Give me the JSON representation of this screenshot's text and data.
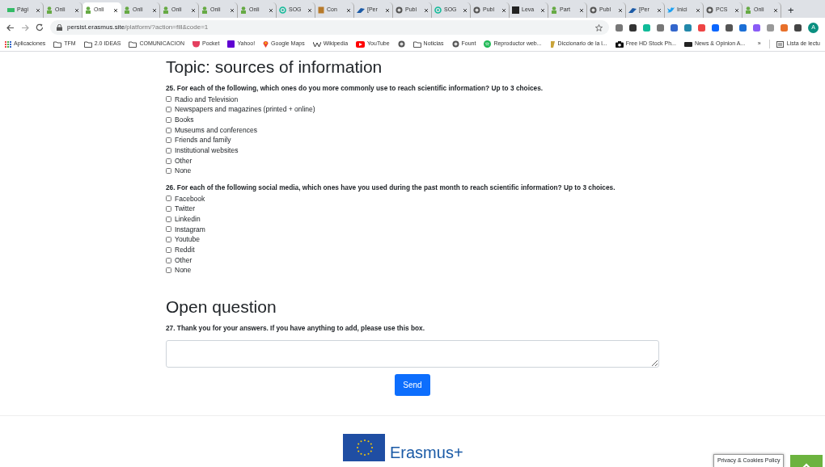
{
  "browser": {
    "tabs": [
      {
        "title": "Pági",
        "kind": "sp",
        "selected": false
      },
      {
        "title": "Onli",
        "kind": "person",
        "selected": false
      },
      {
        "title": "Onli",
        "kind": "person",
        "selected": true
      },
      {
        "title": "Onli",
        "kind": "person",
        "selected": false
      },
      {
        "title": "Onli",
        "kind": "person",
        "selected": false
      },
      {
        "title": "Onli",
        "kind": "person",
        "selected": false
      },
      {
        "title": "Onli",
        "kind": "person",
        "selected": false
      },
      {
        "title": "SOG",
        "kind": "ring",
        "selected": false
      },
      {
        "title": "Con",
        "kind": "book",
        "selected": false
      },
      {
        "title": "[Per",
        "kind": "wing",
        "selected": false
      },
      {
        "title": "Publ",
        "kind": "globe",
        "selected": false
      },
      {
        "title": "SOG",
        "kind": "ring",
        "selected": false
      },
      {
        "title": "Publ",
        "kind": "globe",
        "selected": false
      },
      {
        "title": "Leva",
        "kind": "lv",
        "selected": false
      },
      {
        "title": "Part",
        "kind": "person",
        "selected": false
      },
      {
        "title": "Publ",
        "kind": "globe",
        "selected": false
      },
      {
        "title": "[Per",
        "kind": "wing",
        "selected": false
      },
      {
        "title": "Inici",
        "kind": "bird",
        "selected": false
      },
      {
        "title": "PCS",
        "kind": "globe",
        "selected": false
      },
      {
        "title": "Onli",
        "kind": "person",
        "selected": false
      }
    ],
    "new_tab": "+",
    "address": {
      "domain": "persist.erasmus.site",
      "path": "/platform/?action=fill&code=1"
    },
    "profile": "A",
    "bookmarks": [
      {
        "label": "Aplicaciones",
        "kind": "apps"
      },
      {
        "label": "TFM",
        "kind": "folder"
      },
      {
        "label": "2.0 IDEAS",
        "kind": "folder"
      },
      {
        "label": "COMUNICACION",
        "kind": "folder"
      },
      {
        "label": "Pocket",
        "kind": "pocket"
      },
      {
        "label": "Yahoo!",
        "kind": "yahoo"
      },
      {
        "label": "Google Maps",
        "kind": "pin"
      },
      {
        "label": "Wikipedia",
        "kind": "wiki"
      },
      {
        "label": "YouTube",
        "kind": "youtube"
      },
      {
        "kind": "globe"
      },
      {
        "label": "Noticias",
        "kind": "folder"
      },
      {
        "label": "Fount",
        "kind": "globe"
      },
      {
        "label": "Reproductor web...",
        "kind": "spotify"
      },
      {
        "label": "Diccionario de la l...",
        "kind": "dict"
      },
      {
        "label": "Free HD Stock Ph...",
        "kind": "camera"
      },
      {
        "label": "News & Opinion A...",
        "kind": "ts"
      }
    ],
    "overflow": "»",
    "reading_list": "Lista de lectu"
  },
  "page": {
    "sections": [
      {
        "heading": "Topic: sources of information",
        "questions": [
          {
            "prompt": "25. For each of the following, which ones do you more commonly use to reach scientific information? Up to 3 choices.",
            "kind": "checkbox",
            "options": [
              {
                "label": "Radio and Television",
                "checked": false
              },
              {
                "label": "Newspapers and magazines (printed + online)",
                "checked": false
              },
              {
                "label": "Books",
                "checked": false
              },
              {
                "label": "Museums and conferences",
                "checked": false
              },
              {
                "label": "Friends and family",
                "checked": false
              },
              {
                "label": "Institutional websites",
                "checked": false
              },
              {
                "label": "Other",
                "checked": false
              },
              {
                "label": "None",
                "checked": false
              }
            ]
          },
          {
            "prompt": "26. For each of the following social media, which ones have you used during the past month to reach scientific information? Up to 3 choices.",
            "kind": "checkbox",
            "options": [
              {
                "label": "Facebook",
                "checked": false
              },
              {
                "label": "Twitter",
                "checked": false
              },
              {
                "label": "Linkedin",
                "checked": false
              },
              {
                "label": "Instagram",
                "checked": false
              },
              {
                "label": "Youtube",
                "checked": false
              },
              {
                "label": "Reddit",
                "checked": false
              },
              {
                "label": "Other",
                "checked": false
              },
              {
                "label": "None",
                "checked": false
              }
            ]
          }
        ]
      },
      {
        "heading": "Open question",
        "questions": [
          {
            "prompt": "27. Thank you for your answers. If you have anything to add, please use this box.",
            "kind": "textarea"
          }
        ]
      }
    ],
    "submit": "Send",
    "footer_logo": "Erasmus+",
    "cookie_notice": "Privacy & Cookies Policy"
  }
}
